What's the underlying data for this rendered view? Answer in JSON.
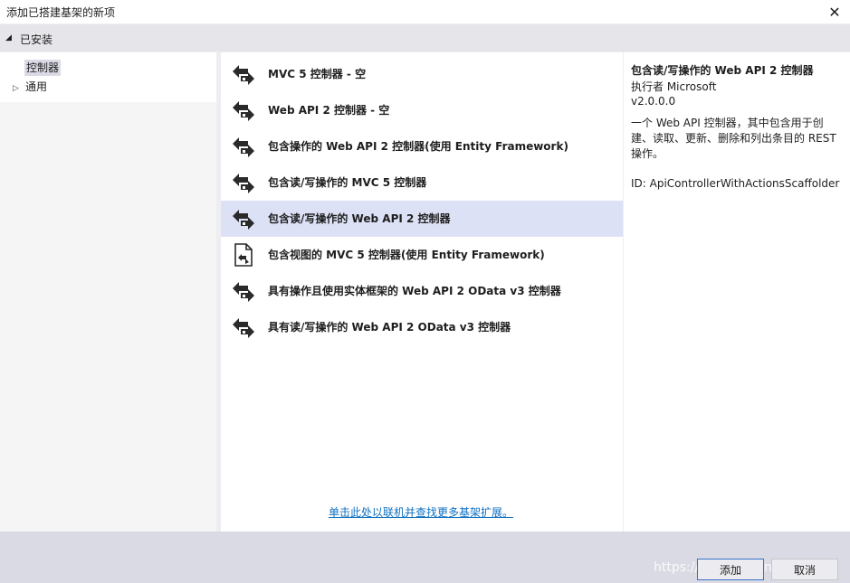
{
  "window": {
    "title": "添加已搭建基架的新项"
  },
  "installed": {
    "label": "已安装"
  },
  "tree": [
    {
      "label": "控制器"
    },
    {
      "label": "通用"
    }
  ],
  "scaffolders": [
    {
      "label": "MVC 5 控制器 - 空",
      "icon": "controller-icon"
    },
    {
      "label": "Web API 2 控制器 - 空",
      "icon": "controller-icon"
    },
    {
      "label": "包含操作的 Web API 2 控制器(使用 Entity Framework)",
      "icon": "controller-icon"
    },
    {
      "label": "包含读/写操作的 MVC 5 控制器",
      "icon": "controller-icon"
    },
    {
      "label": "包含读/写操作的 Web API 2 控制器",
      "icon": "controller-icon",
      "selected": true
    },
    {
      "label": "包含视图的 MVC 5 控制器(使用 Entity Framework)",
      "icon": "view-controller-icon"
    },
    {
      "label": "具有操作且使用实体框架的 Web API 2 OData v3 控制器",
      "icon": "controller-icon"
    },
    {
      "label": "具有读/写操作的 Web API 2 OData v3 控制器",
      "icon": "controller-icon"
    }
  ],
  "more_link": "单击此处以联机并查找更多基架扩展。",
  "details": {
    "title": "包含读/写操作的 Web API 2 控制器",
    "author": "执行者 Microsoft",
    "version": "v2.0.0.0",
    "description": "一个 Web API 控制器，其中包含用于创建、读取、更新、删除和列出条目的 REST 操作。",
    "id": "ID: ApiControllerWithActionsScaffolder"
  },
  "buttons": {
    "add": "添加",
    "cancel": "取消"
  },
  "watermark": "https://blog.csdn.net/zarkuo",
  "colors": {
    "selected_row": "#dde1f6",
    "link": "#0e70c0",
    "footer": "#dadae5"
  }
}
